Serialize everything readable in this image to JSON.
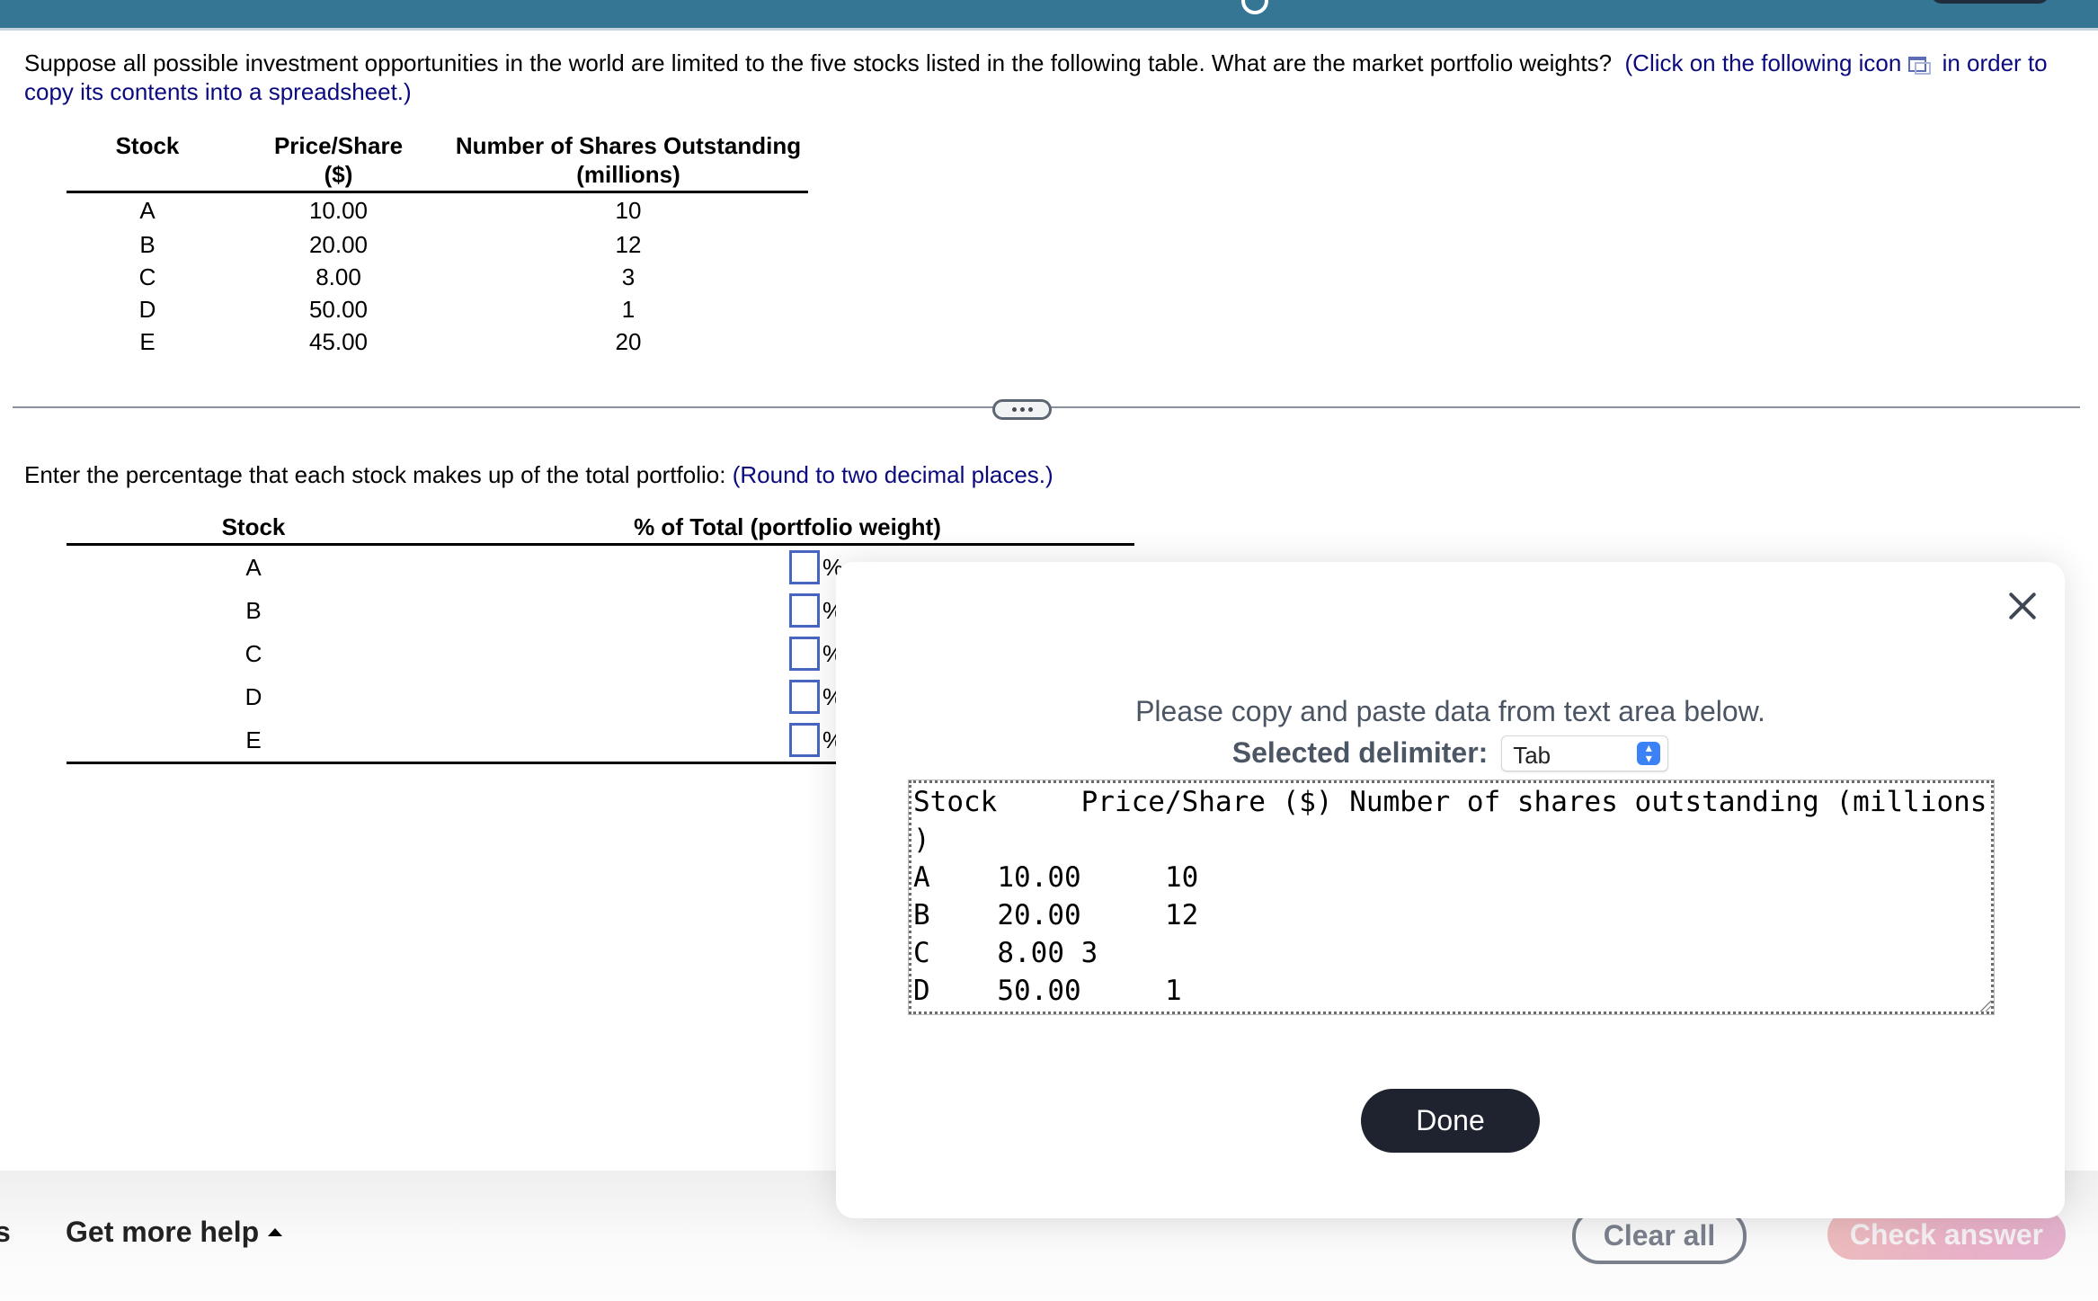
{
  "question": {
    "text": "Suppose all possible investment opportunities in the world are limited to the five stocks listed in the following table. What are the market portfolio weights?",
    "hint_before_icon": "(Click on the following icon",
    "hint_after_icon": "in order to copy its contents into a spreadsheet.)",
    "icon": "copy-to-spreadsheet-icon"
  },
  "data_table": {
    "headers": [
      {
        "line1": "Stock",
        "line2": ""
      },
      {
        "line1": "Price/Share",
        "line2": "($)"
      },
      {
        "line1": "Number of Shares Outstanding",
        "line2": "(millions)"
      }
    ],
    "rows": [
      [
        "A",
        "10.00",
        "10"
      ],
      [
        "B",
        "20.00",
        "12"
      ],
      [
        "C",
        "8.00",
        "3"
      ],
      [
        "D",
        "50.00",
        "1"
      ],
      [
        "E",
        "45.00",
        "20"
      ]
    ]
  },
  "separator": {
    "icon": "more-dots-icon"
  },
  "prompt": {
    "text": "Enter the percentage that each stock makes up of the total portfolio:",
    "hint": "(Round to two decimal places.)"
  },
  "answer_table": {
    "headers": [
      "Stock",
      "% of Total (portfolio weight)"
    ],
    "rows": [
      {
        "stock": "A",
        "value": "",
        "unit": "%"
      },
      {
        "stock": "B",
        "value": "",
        "unit": "%"
      },
      {
        "stock": "C",
        "value": "",
        "unit": "%"
      },
      {
        "stock": "D",
        "value": "",
        "unit": "%"
      },
      {
        "stock": "E",
        "value": "",
        "unit": "%"
      }
    ]
  },
  "modal": {
    "instruction": "Please copy and paste data from text area below.",
    "delimiter_label": "Selected delimiter:",
    "delimiter_value": "Tab",
    "textarea_content": "Stock\tPrice/Share ($) Number of shares outstanding (millions\n)\nA\t10.00\t10\nB\t20.00\t12\nC\t8.00\t3\nD\t50.00\t1",
    "done_label": "Done",
    "close_icon": "close-icon"
  },
  "footer": {
    "partial_left": "s",
    "help_label": "Get more help",
    "clear_label": "Clear all",
    "check_label": "Check answer"
  },
  "colors": {
    "topbar": "#357694",
    "link_blue": "#0a0a7e",
    "input_border": "#4766c0",
    "done_button": "#1f2330",
    "check_answer": "#e9b0c8"
  }
}
